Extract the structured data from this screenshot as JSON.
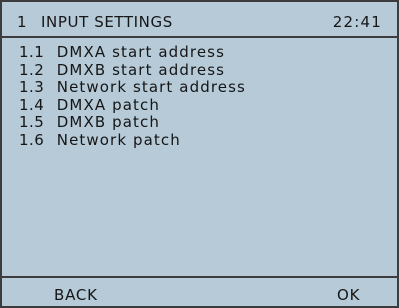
{
  "header": {
    "menu_number": "1",
    "title": "INPUT SETTINGS",
    "time": "22:41"
  },
  "menu": {
    "items": [
      {
        "number": "1.1",
        "label": "DMXA start address"
      },
      {
        "number": "1.2",
        "label": "DMXB start address"
      },
      {
        "number": "1.3",
        "label": "Network start address"
      },
      {
        "number": "1.4",
        "label": "DMXA patch"
      },
      {
        "number": "1.5",
        "label": "DMXB patch"
      },
      {
        "number": "1.6",
        "label": "Network patch"
      }
    ]
  },
  "footer": {
    "left_key": "BACK",
    "right_key": "OK"
  }
}
